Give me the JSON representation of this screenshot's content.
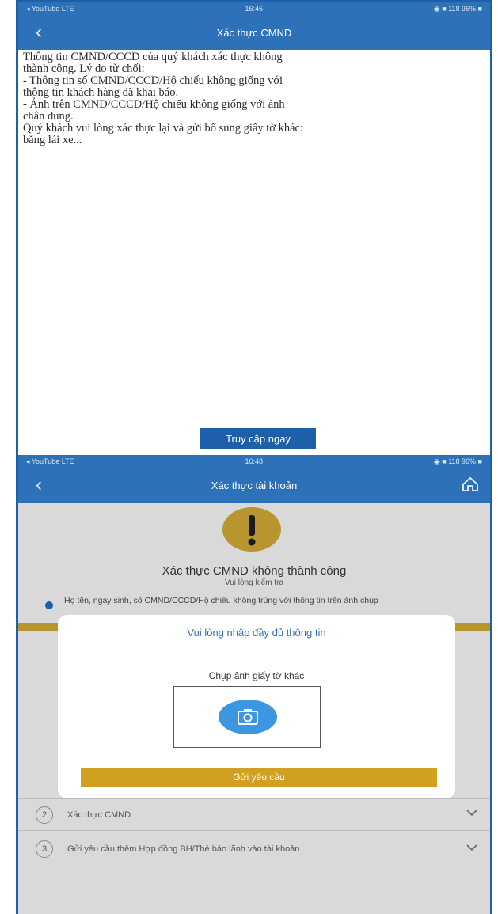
{
  "top_screen": {
    "status_bar": {
      "left": "◂ YouTube  LTE",
      "time": "16:46",
      "right": "◉ ■ 118 96% ■"
    },
    "title": "Xác thực CMND",
    "message_lines": [
      "Thông tin CMND/CCCD của quý khách xác thực không",
      "thành công. Lý do từ chối:",
      "- Thông tin số CMND/CCCD/Hộ chiếu không giống với",
      "thông tin khách hàng đã khai báo.",
      "- Ảnh trên CMND/CCCD/Hộ chiếu không giống với ảnh",
      "chân dung.",
      "Quý khách vui lòng xác thực lại và gửi bổ sung giấy tờ khác:",
      "bằng lái xe..."
    ],
    "access_button": "Truy cập ngay"
  },
  "bottom_screen": {
    "status_bar": {
      "left": "◂ YouTube  LTE",
      "time": "16:48",
      "right": "◉ ■ 118 96% ■"
    },
    "title": "Xác thực tài khoản",
    "warning_title": "Xác thực CMND không thành công",
    "warning_subtitle": "Vui lòng kiểm tra",
    "reason": "Họ tên, ngày sinh, số CMND/CCCD/Hộ chiếu không trùng với thông tin trên ảnh chụp",
    "steps": [
      {
        "number": "2",
        "label": "Xác thực CMND"
      },
      {
        "number": "3",
        "label": "Gửi yêu cầu thêm Hợp đồng BH/Thẻ bảo lãnh vào tài khoản"
      }
    ],
    "modal": {
      "title": "Vui lòng nhập đầy đủ thông tin",
      "upload_label": "Chụp ảnh giấy tờ khác",
      "submit_button": "Gửi yêu cầu"
    }
  },
  "colors": {
    "primary_blue": "#2d72b8",
    "gold": "#b8952e",
    "submit_gold": "#d1a020",
    "camera_blue": "#3d97e0"
  }
}
